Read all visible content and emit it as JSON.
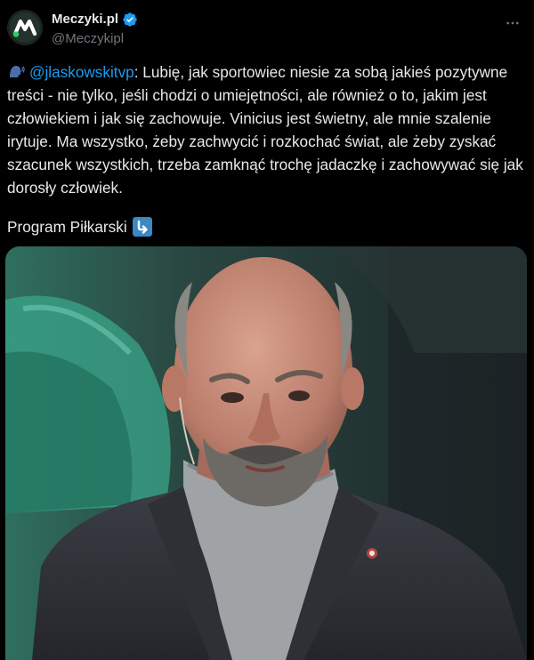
{
  "author": {
    "display_name": "Meczyki.pl",
    "handle": "@Meczykipl",
    "verified": true,
    "avatar_icon": "meczyki-logo-icon"
  },
  "tweet": {
    "lead_emoji": "speaking-head-icon",
    "mention": "@jlaskowskitvp",
    "body": ": Lubię, jak sportowiec niesie za sobą jakieś pozytywne treści - nie tylko, jeśli chodzi o umiejętności, ale również o to, jakim jest człowiekiem i jak się zachowuje. Vinicius jest świetny, ale mnie szalenie irytuje. Ma wszystko, żeby zachwycić i rozkochać świat, ale żeby zyskać szacunek wszystkich, trzeba zamknąć trochę jadaczkę i zachowywać się jak dorosły człowiek.",
    "program_label": "Program Piłkarski",
    "program_emoji": "arrow-down-right-icon"
  },
  "media": {
    "kind": "photo",
    "description_icon": "studio-guest-photo"
  },
  "colors": {
    "background": "#000000",
    "text": "#e7e9ea",
    "secondary": "#71767b",
    "accent": "#1d9bf0",
    "verified": "#1d9bf0"
  }
}
